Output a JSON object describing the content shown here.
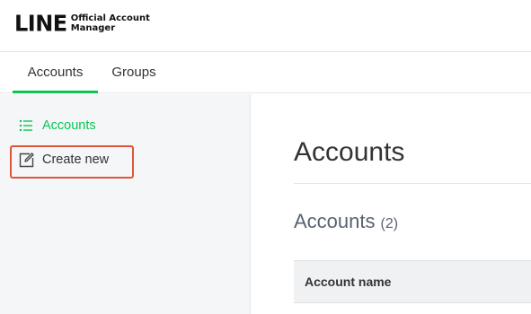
{
  "header": {
    "logo_mark": "LINE",
    "logo_line1": "Official Account",
    "logo_line2": "Manager"
  },
  "tabs": [
    {
      "label": "Accounts",
      "active": true
    },
    {
      "label": "Groups",
      "active": false
    }
  ],
  "sidebar": {
    "items": [
      {
        "label": "Accounts",
        "icon": "list-icon",
        "active": true
      },
      {
        "label": "Create new",
        "icon": "edit-icon",
        "active": false
      }
    ]
  },
  "main": {
    "title": "Accounts",
    "section_title": "Accounts",
    "section_count": "(2)",
    "table": {
      "columns": [
        "Account name"
      ]
    }
  },
  "colors": {
    "accent": "#06c755",
    "highlight": "#e0553a"
  }
}
